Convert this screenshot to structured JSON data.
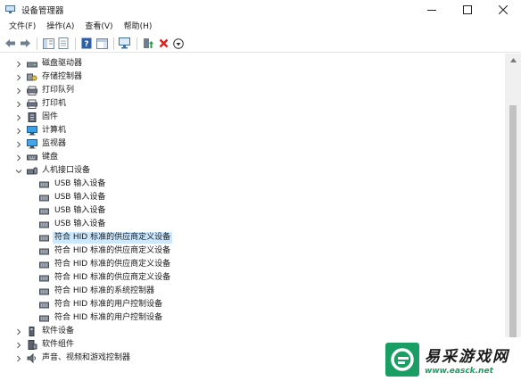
{
  "window": {
    "title": "设备管理器",
    "controls": [
      "minimize-icon",
      "maximize-icon",
      "close-icon"
    ]
  },
  "menu": [
    "文件(F)",
    "操作(A)",
    "查看(V)",
    "帮助(H)"
  ],
  "toolbar": [
    "back-arrow-icon",
    "forward-arrow-icon",
    "show-hide-tree-icon",
    "properties-icon",
    "help-icon",
    "action-pane-icon",
    "scan-hardware-icon",
    "update-driver-icon",
    "uninstall-device-icon",
    "download-icon"
  ],
  "tree": {
    "items": [
      {
        "label": "磁盘驱动器",
        "level": 1,
        "state": "collapsed",
        "icon": "disk-drive-icon"
      },
      {
        "label": "存储控制器",
        "level": 1,
        "state": "collapsed",
        "icon": "storage-controller-icon"
      },
      {
        "label": "打印队列",
        "level": 1,
        "state": "collapsed",
        "icon": "printer-queue-icon"
      },
      {
        "label": "打印机",
        "level": 1,
        "state": "collapsed",
        "icon": "printer-icon"
      },
      {
        "label": "固件",
        "level": 1,
        "state": "collapsed",
        "icon": "firmware-icon"
      },
      {
        "label": "计算机",
        "level": 1,
        "state": "collapsed",
        "icon": "computer-icon"
      },
      {
        "label": "监视器",
        "level": 1,
        "state": "collapsed",
        "icon": "monitor-icon"
      },
      {
        "label": "键盘",
        "level": 1,
        "state": "collapsed",
        "icon": "keyboard-icon"
      },
      {
        "label": "人机接口设备",
        "level": 1,
        "state": "expanded",
        "icon": "hid-icon"
      },
      {
        "label": "USB 输入设备",
        "level": 2,
        "state": "leaf",
        "icon": "hid-device-icon"
      },
      {
        "label": "USB 输入设备",
        "level": 2,
        "state": "leaf",
        "icon": "hid-device-icon"
      },
      {
        "label": "USB 输入设备",
        "level": 2,
        "state": "leaf",
        "icon": "hid-device-icon"
      },
      {
        "label": "USB 输入设备",
        "level": 2,
        "state": "leaf",
        "icon": "hid-device-icon"
      },
      {
        "label": "符合 HID 标准的供应商定义设备",
        "level": 2,
        "state": "leaf",
        "icon": "hid-device-icon",
        "selected": true
      },
      {
        "label": "符合 HID 标准的供应商定义设备",
        "level": 2,
        "state": "leaf",
        "icon": "hid-device-icon"
      },
      {
        "label": "符合 HID 标准的供应商定义设备",
        "level": 2,
        "state": "leaf",
        "icon": "hid-device-icon"
      },
      {
        "label": "符合 HID 标准的供应商定义设备",
        "level": 2,
        "state": "leaf",
        "icon": "hid-device-icon"
      },
      {
        "label": "符合 HID 标准的系统控制器",
        "level": 2,
        "state": "leaf",
        "icon": "hid-device-icon"
      },
      {
        "label": "符合 HID 标准的用户控制设备",
        "level": 2,
        "state": "leaf",
        "icon": "hid-device-icon"
      },
      {
        "label": "符合 HID 标准的用户控制设备",
        "level": 2,
        "state": "leaf",
        "icon": "hid-device-icon"
      },
      {
        "label": "软件设备",
        "level": 1,
        "state": "collapsed",
        "icon": "software-device-icon"
      },
      {
        "label": "软件组件",
        "level": 1,
        "state": "collapsed",
        "icon": "software-component-icon"
      },
      {
        "label": "声音、视频和游戏控制器",
        "level": 1,
        "state": "collapsed",
        "icon": "audio-icon"
      }
    ]
  },
  "watermark": {
    "title": "易采游戏网",
    "url": "www.easck.net"
  },
  "colors": {
    "selection": "#cce8ff",
    "scrollbar_thumb": "#c2c2c2",
    "watermark_green": "#1b9e63"
  }
}
